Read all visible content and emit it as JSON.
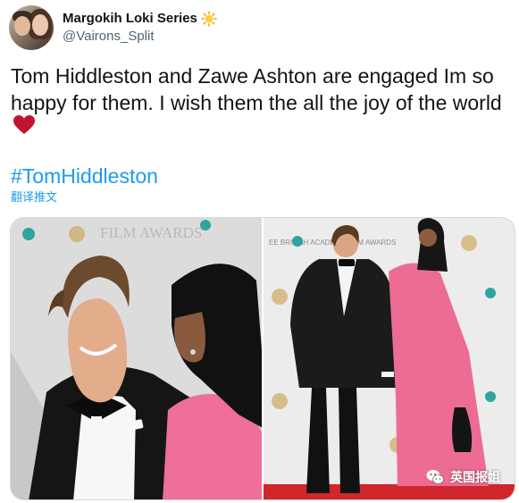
{
  "tweet": {
    "display_name": "Margokih Loki Series",
    "handle": "@Vairons_Split",
    "text": "Tom Hiddleston and Zawe Ashton are engaged Im so happy for them. I wish them the all the joy of the world",
    "hashtag": "#TomHiddleston",
    "translate_label": "翻译推文"
  },
  "icons": {
    "name_emoji": "sun-icon",
    "text_emoji": "heart-icon",
    "watermark_icon": "wechat-icon"
  },
  "media": {
    "watermark": "英国报姐",
    "backdrop_left": "FILM AWARDS",
    "backdrop_right": "EE BRITISH ACADEMY FILM AWARDS"
  },
  "colors": {
    "link": "#1d9bf0",
    "text": "#0f1419",
    "muted": "#536471",
    "heart": "#c0152f",
    "dress": "#e9668f"
  }
}
